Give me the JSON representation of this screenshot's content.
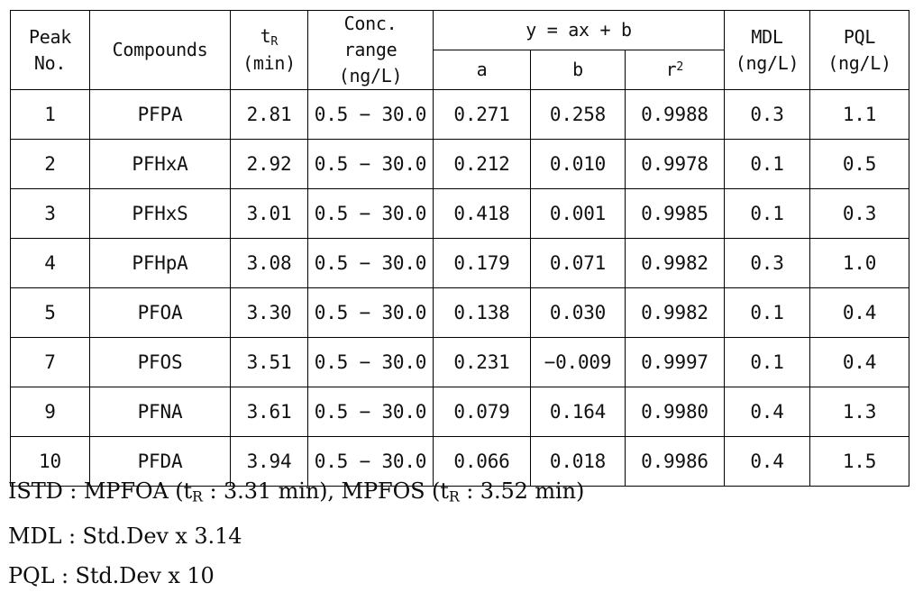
{
  "table": {
    "headers": {
      "peak_no": [
        "Peak",
        "No."
      ],
      "compounds": "Compounds",
      "tr": {
        "symbol": "t",
        "subscript": "R",
        "unit": "(min)"
      },
      "conc_range": [
        "Conc.",
        "range",
        "(ng/L)"
      ],
      "equation": "y = ax + b",
      "a": "a",
      "b": "b",
      "r2": {
        "symbol": "r",
        "superscript": "2"
      },
      "mdl": {
        "name": "MDL",
        "unit": "(ng/L)"
      },
      "pql": {
        "name": "PQL",
        "unit": "(ng/L)"
      }
    },
    "rows": [
      {
        "peak_no": "1",
        "compound": "PFPA",
        "tr": "2.81",
        "conc_range": "0.5 − 30.0",
        "a": "0.271",
        "b": "0.258",
        "r2": "0.9988",
        "mdl": "0.3",
        "pql": "1.1"
      },
      {
        "peak_no": "2",
        "compound": "PFHxA",
        "tr": "2.92",
        "conc_range": "0.5 − 30.0",
        "a": "0.212",
        "b": "0.010",
        "r2": "0.9978",
        "mdl": "0.1",
        "pql": "0.5"
      },
      {
        "peak_no": "3",
        "compound": "PFHxS",
        "tr": "3.01",
        "conc_range": "0.5 − 30.0",
        "a": "0.418",
        "b": "0.001",
        "r2": "0.9985",
        "mdl": "0.1",
        "pql": "0.3"
      },
      {
        "peak_no": "4",
        "compound": "PFHpA",
        "tr": "3.08",
        "conc_range": "0.5 − 30.0",
        "a": "0.179",
        "b": "0.071",
        "r2": "0.9982",
        "mdl": "0.3",
        "pql": "1.0"
      },
      {
        "peak_no": "5",
        "compound": "PFOA",
        "tr": "3.30",
        "conc_range": "0.5 − 30.0",
        "a": "0.138",
        "b": "0.030",
        "r2": "0.9982",
        "mdl": "0.1",
        "pql": "0.4"
      },
      {
        "peak_no": "7",
        "compound": "PFOS",
        "tr": "3.51",
        "conc_range": "0.5 − 30.0",
        "a": "0.231",
        "b": "−0.009",
        "r2": "0.9997",
        "mdl": "0.1",
        "pql": "0.4"
      },
      {
        "peak_no": "9",
        "compound": "PFNA",
        "tr": "3.61",
        "conc_range": "0.5 − 30.0",
        "a": "0.079",
        "b": "0.164",
        "r2": "0.9980",
        "mdl": "0.4",
        "pql": "1.3"
      },
      {
        "peak_no": "10",
        "compound": "PFDA",
        "tr": "3.94",
        "conc_range": "0.5 − 30.0",
        "a": "0.066",
        "b": "0.018",
        "r2": "0.9986",
        "mdl": "0.4",
        "pql": "1.5"
      }
    ]
  },
  "notes": {
    "istd": {
      "prefix": "ISTD : MPFOA (t",
      "sub1": "R",
      "mid": " : 3.31 min), MPFOS (t",
      "sub2": "R",
      "suffix": " : 3.52 min)"
    },
    "mdl": "MDL : Std.Dev x 3.14",
    "pql": "PQL : Std.Dev x 10"
  }
}
